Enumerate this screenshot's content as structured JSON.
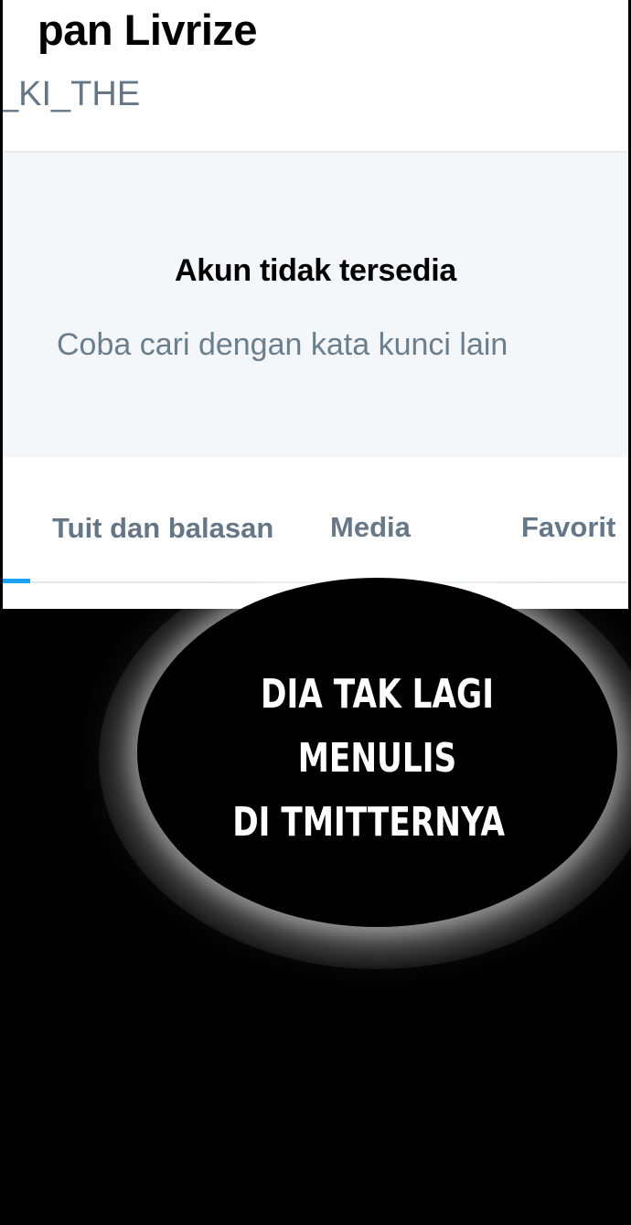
{
  "profile": {
    "display_name": "pan Livrize",
    "handle": "_KI_THE"
  },
  "empty_state": {
    "title": "Akun tidak tersedia",
    "subtitle": "Coba cari dengan kata kunci lain"
  },
  "tabs": [
    {
      "label": "Tuit dan balasan",
      "active": true
    },
    {
      "label": "Media",
      "active": false
    },
    {
      "label": "Favorit",
      "active": false
    }
  ],
  "speech_bubble": {
    "lines": [
      "DIA TAK LAGI",
      "MENULIS",
      "DI TMITTERNYA"
    ]
  },
  "colors": {
    "tab_indicator": "#1da1f2",
    "muted_text": "#657786",
    "empty_bg": "#f4f7fa",
    "comic_bg": "#000000"
  }
}
